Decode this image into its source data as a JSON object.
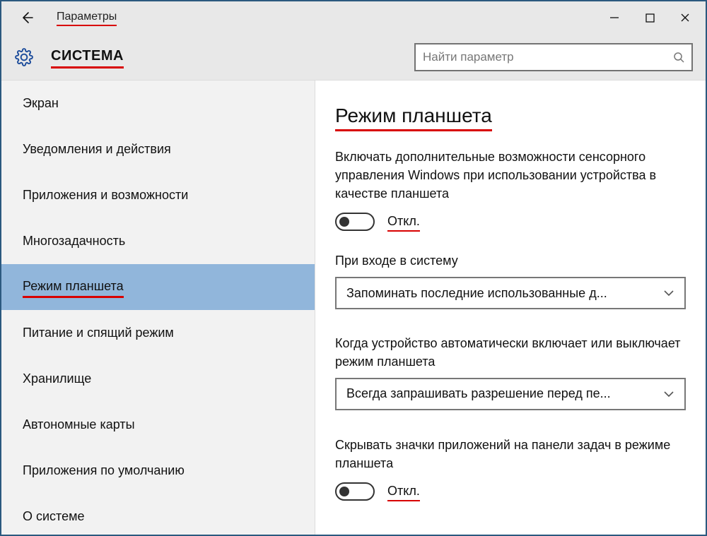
{
  "window": {
    "title": "Параметры",
    "category": "СИСТЕМА"
  },
  "search": {
    "placeholder": "Найти параметр"
  },
  "sidebar": {
    "items": [
      {
        "label": "Экран",
        "selected": false
      },
      {
        "label": "Уведомления и действия",
        "selected": false
      },
      {
        "label": "Приложения и возможности",
        "selected": false
      },
      {
        "label": "Многозадачность",
        "selected": false
      },
      {
        "label": "Режим планшета",
        "selected": true
      },
      {
        "label": "Питание и спящий режим",
        "selected": false
      },
      {
        "label": "Хранилище",
        "selected": false
      },
      {
        "label": "Автономные карты",
        "selected": false
      },
      {
        "label": "Приложения по умолчанию",
        "selected": false
      },
      {
        "label": "О системе",
        "selected": false
      }
    ]
  },
  "main": {
    "heading": "Режим планшета",
    "toggle1_desc": "Включать дополнительные возможности сенсорного управления Windows при использовании устройства в качестве планшета",
    "toggle1_state_label": "Откл.",
    "toggle1_state": "off",
    "dropdown1_label": "При входе в систему",
    "dropdown1_value": "Запоминать последние использованные д...",
    "dropdown2_label": "Когда устройство автоматически включает или выключает режим планшета",
    "dropdown2_value": "Всегда запрашивать разрешение перед пе...",
    "toggle2_desc": "Скрывать значки приложений на панели задач в режиме планшета",
    "toggle2_state_label": "Откл.",
    "toggle2_state": "off"
  }
}
